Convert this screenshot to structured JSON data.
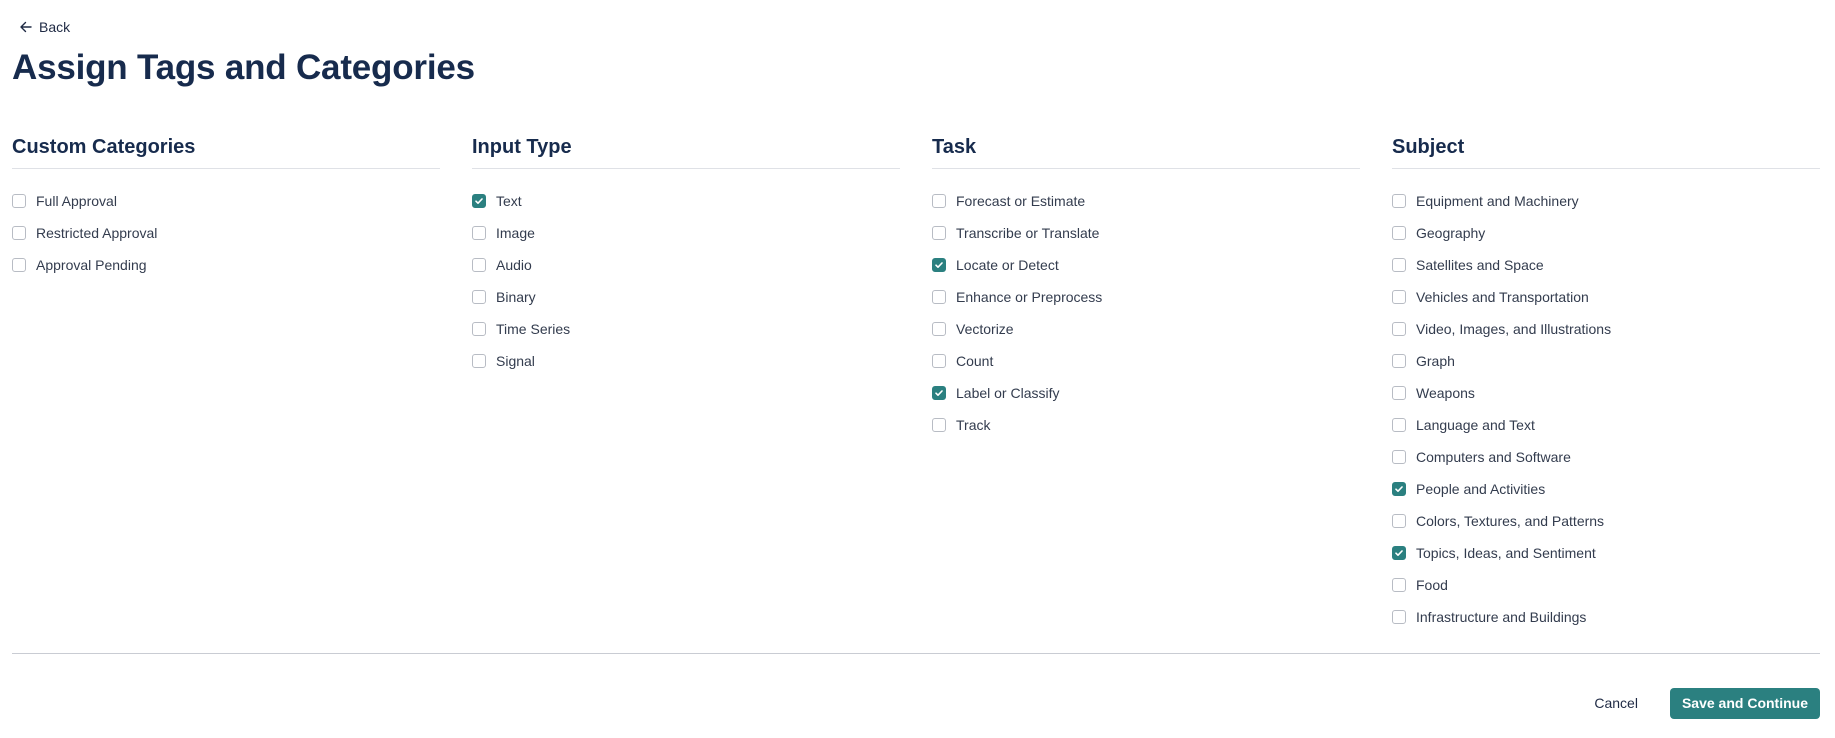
{
  "nav": {
    "back_label": "Back"
  },
  "page": {
    "title": "Assign Tags and Categories"
  },
  "columns": [
    {
      "title": "Custom Categories",
      "options": [
        {
          "label": "Full Approval",
          "checked": false
        },
        {
          "label": "Restricted Approval",
          "checked": false
        },
        {
          "label": "Approval Pending",
          "checked": false
        }
      ]
    },
    {
      "title": "Input Type",
      "options": [
        {
          "label": "Text",
          "checked": true
        },
        {
          "label": "Image",
          "checked": false
        },
        {
          "label": "Audio",
          "checked": false
        },
        {
          "label": "Binary",
          "checked": false
        },
        {
          "label": "Time Series",
          "checked": false
        },
        {
          "label": "Signal",
          "checked": false
        }
      ]
    },
    {
      "title": "Task",
      "options": [
        {
          "label": "Forecast or Estimate",
          "checked": false
        },
        {
          "label": "Transcribe or Translate",
          "checked": false
        },
        {
          "label": "Locate or Detect",
          "checked": true
        },
        {
          "label": "Enhance or Preprocess",
          "checked": false
        },
        {
          "label": "Vectorize",
          "checked": false
        },
        {
          "label": "Count",
          "checked": false
        },
        {
          "label": "Label or Classify",
          "checked": true
        },
        {
          "label": "Track",
          "checked": false
        }
      ]
    },
    {
      "title": "Subject",
      "options": [
        {
          "label": "Equipment and Machinery",
          "checked": false
        },
        {
          "label": "Geography",
          "checked": false
        },
        {
          "label": "Satellites and Space",
          "checked": false
        },
        {
          "label": "Vehicles and Transportation",
          "checked": false
        },
        {
          "label": "Video, Images, and Illustrations",
          "checked": false
        },
        {
          "label": "Graph",
          "checked": false
        },
        {
          "label": "Weapons",
          "checked": false
        },
        {
          "label": "Language and Text",
          "checked": false
        },
        {
          "label": "Computers and Software",
          "checked": false
        },
        {
          "label": "People and Activities",
          "checked": true
        },
        {
          "label": "Colors, Textures, and Patterns",
          "checked": false
        },
        {
          "label": "Topics, Ideas, and Sentiment",
          "checked": true
        },
        {
          "label": "Food",
          "checked": false
        },
        {
          "label": "Infrastructure and Buildings",
          "checked": false
        }
      ]
    }
  ],
  "footer": {
    "cancel_label": "Cancel",
    "save_label": "Save and Continue"
  },
  "icons": {
    "back": "arrow-left-icon",
    "check": "checkmark-icon"
  },
  "colors": {
    "accent": "#2b8080",
    "title": "#172b4d",
    "text": "#333c4e",
    "checkbox_border": "#b8bcc4",
    "divider": "#c9ccd3"
  }
}
